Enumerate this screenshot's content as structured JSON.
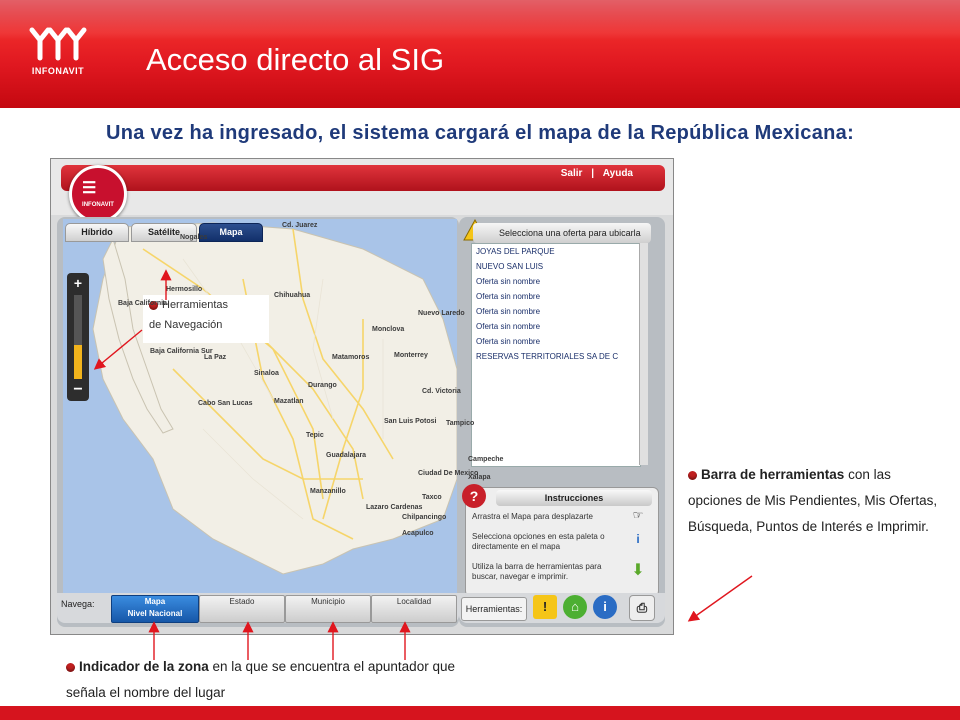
{
  "slide": {
    "logo_text": "INFONAVIT",
    "title": "Acceso directo al SIG",
    "subtitle": "Una vez ha ingresado, el sistema cargará el mapa de la República Mexicana:"
  },
  "app": {
    "logo_text": "INFONAVIT",
    "top_links": {
      "salir": "Salir",
      "separator": "|",
      "ayuda": "Ayuda"
    },
    "map_tabs": [
      {
        "label": "Híbrido",
        "active": false
      },
      {
        "label": "Satélite",
        "active": false
      },
      {
        "label": "Mapa",
        "active": true
      }
    ],
    "zoom": {
      "plus": "+",
      "minus": "−",
      "level": 0.4
    },
    "cities": [
      "Cd. Juarez",
      "Nogales",
      "Hermosillo",
      "Chihuahua",
      "Nuevo Laredo",
      "Monclova",
      "Monterrey",
      "Matamoros",
      "Durango",
      "Cd. Victoria",
      "La Paz",
      "Cabo San Lucas",
      "Mazatlan",
      "San Luis Potosi",
      "Tampico",
      "Tepic",
      "Guadalajara",
      "Ciudad De Mexico",
      "Manzanillo",
      "Lazaro Cardenas",
      "Taxco",
      "Chilpancingo",
      "Acapulco",
      "Xalapa",
      "Baja California",
      "Baja California Sur",
      "Sinaloa",
      "Campeche"
    ],
    "ofertas": {
      "header": "Selecciona una oferta para ubicarla",
      "items": [
        "JOYAS DEL PARQUE",
        "NUEVO SAN LUIS",
        "Oferta sin nombre",
        "Oferta sin nombre",
        "Oferta sin nombre",
        "Oferta sin nombre",
        "Oferta sin nombre",
        "RESERVAS TERRITORIALES SA DE C"
      ]
    },
    "instrucciones": {
      "header": "Instrucciones",
      "q_icon": "?",
      "line1": "Arrastra el Mapa para desplazarte",
      "line2": "Selecciona opciones en esta paleta o directamente en el mapa",
      "line3": "Utiliza la barra de herramientas para buscar, navegar e imprimir."
    },
    "navega": {
      "label": "Navega:",
      "steps": [
        {
          "label": "Mapa",
          "sub": "Nivel Nacional",
          "active": true
        },
        {
          "label": "Estado",
          "sub": "",
          "active": false
        },
        {
          "label": "Municipio",
          "sub": "",
          "active": false
        },
        {
          "label": "Localidad",
          "sub": "",
          "active": false
        }
      ]
    },
    "herramientas": {
      "label": "Herramientas:",
      "warning_symbol": "!",
      "info_symbol": "i"
    }
  },
  "callouts": {
    "navegacion_line1": "Herramientas",
    "navegacion_line2": "de Navegación",
    "barra_bold": "Barra de herramientas",
    "barra_rest": " con las opciones de Mis Pendientes, Mis Ofertas, Búsqueda, Puntos de Interés e Imprimir.",
    "indicador_bold": "Indicador de la zona",
    "indicador_rest": " en la que se encuentra el apuntador que señala el nombre del lugar"
  },
  "colors": {
    "brand_red": "#d40a16",
    "subtitle_blue": "#1f3a7a",
    "nav_active": "#1657a8"
  }
}
